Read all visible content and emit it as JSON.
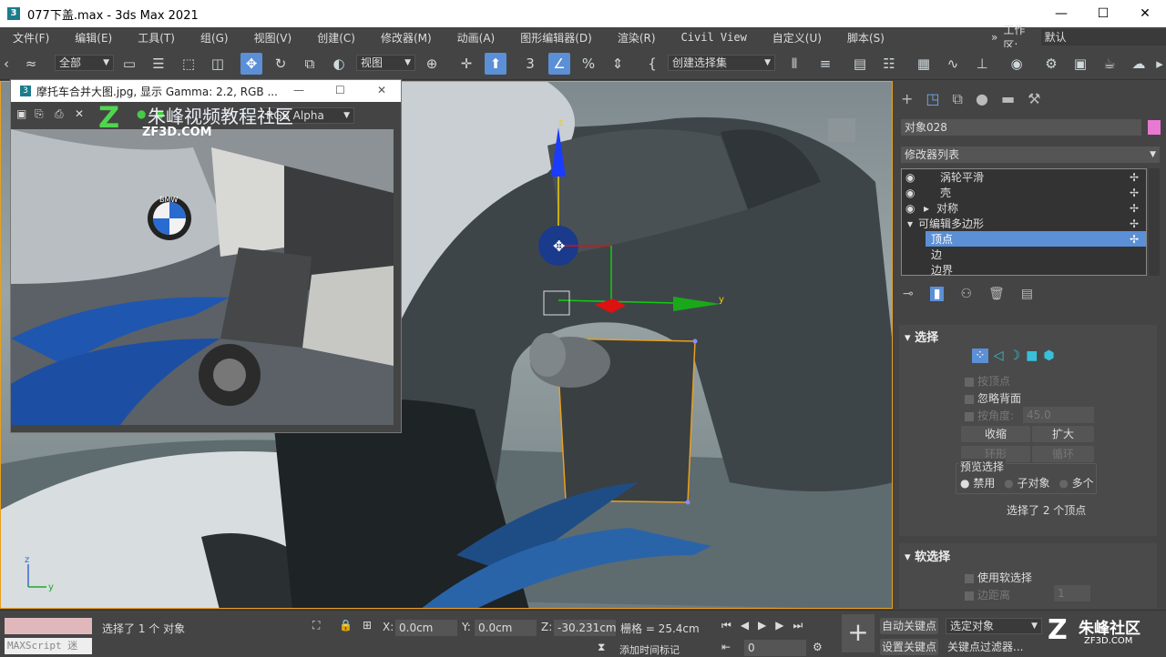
{
  "window": {
    "title": "077下盖.max - 3ds Max 2021",
    "min": "—",
    "max": "☐",
    "close": "✕"
  },
  "menu": [
    "文件(F)",
    "编辑(E)",
    "工具(T)",
    "组(G)",
    "视图(V)",
    "创建(C)",
    "修改器(M)",
    "动画(A)",
    "图形编辑器(D)",
    "渲染(R)",
    "Civil View",
    "自定义(U)",
    "脚本(S)"
  ],
  "workspace": {
    "label": "工作区:",
    "value": "默认",
    "more": "»"
  },
  "toolbar": {
    "filter": "全部",
    "refcoord": "视图",
    "selset": "创建选择集"
  },
  "imagewin": {
    "title": "摩托车合并大图.jpg, 显示 Gamma: 2.2, RGB ...",
    "channel": "RGB Alpha",
    "watermark_cn": "朱峰视频教程社区",
    "watermark_en": "ZF3D.COM",
    "badge": "BMW"
  },
  "viewport": {
    "gizmo_z": "z",
    "gizmo_y": "y",
    "axis_z": "z",
    "axis_y": "y"
  },
  "panel": {
    "object_name": "对象028",
    "object_color": "#e879d2",
    "modlist_label": "修改器列表",
    "stack": [
      {
        "label": "涡轮平滑",
        "indent": 1,
        "eye": true
      },
      {
        "label": "壳",
        "indent": 1,
        "eye": true
      },
      {
        "label": "对称",
        "indent": 1,
        "eye": true,
        "expand": "▸"
      },
      {
        "label": "可编辑多边形",
        "indent": 0,
        "expand": "▾"
      },
      {
        "label": "顶点",
        "indent": 2,
        "selected": true
      },
      {
        "label": "边",
        "indent": 2
      },
      {
        "label": "边界",
        "indent": 2
      }
    ],
    "select_rollout": {
      "title": "选择",
      "by_vertex": "按顶点",
      "ignore_backface": "忽略背面",
      "by_angle": "按角度:",
      "angle_value": "45.0",
      "shrink": "收缩",
      "grow": "扩大",
      "ring": "环形",
      "loop": "循环",
      "preview_label": "预览选择",
      "preview_options": [
        "禁用",
        "子对象",
        "多个"
      ],
      "status": "选择了 2 个顶点"
    },
    "soft_rollout": {
      "title": "软选择",
      "use_soft": "使用软选择",
      "edge_dist": "边距离",
      "edge_value": "1"
    }
  },
  "statusbar": {
    "maxscript": "MAXScript 迷",
    "selected": "选择了 1 个 对象",
    "x_label": "X:",
    "x_value": "0.0cm",
    "y_label": "Y:",
    "y_value": "0.0cm",
    "z_label": "Z:",
    "z_value": "-30.231cm",
    "grid": "栅格 = 25.4cm",
    "add_time_tag": "添加时间标记",
    "auto_key": "自动关键点",
    "set_key": "设置关键点",
    "sel_obj": "选定对象",
    "key_filters": "关键点过滤器...",
    "frame": "0",
    "logo_cn": "朱峰社区",
    "logo_en": "ZF3D.COM"
  }
}
